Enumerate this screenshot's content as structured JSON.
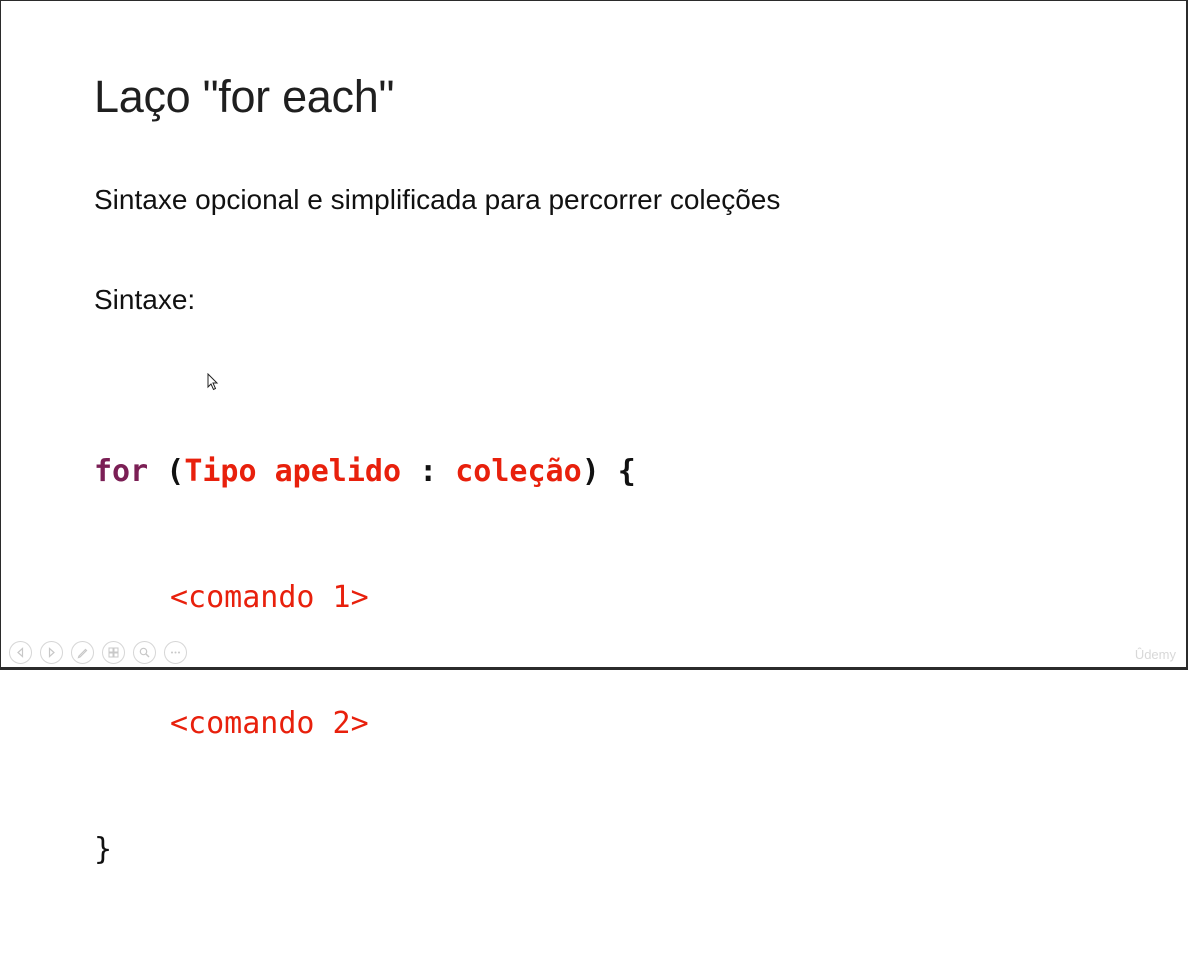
{
  "slide": {
    "title": "Laço \"for each\"",
    "subtitle": "Sintaxe opcional e simplificada para percorrer coleções",
    "syntax_label": "Sintaxe:"
  },
  "code": {
    "kw_for": "for",
    "open_paren": "(",
    "type_alias": "Tipo apelido",
    "colon": ":",
    "collection": "coleção",
    "close_brace_open": ") {",
    "command_1": "<comando 1>",
    "command_2": "<comando 2>",
    "closing_brace": "}"
  },
  "player": {
    "controls": [
      "previous-icon",
      "next-icon",
      "pen-icon",
      "slides-icon",
      "zoom-icon",
      "more-icon"
    ]
  },
  "watermark": {
    "text": "Ûdemy"
  },
  "colors": {
    "keyword": "#7b1f55",
    "highlight": "#e8200c",
    "text": "#111111"
  }
}
